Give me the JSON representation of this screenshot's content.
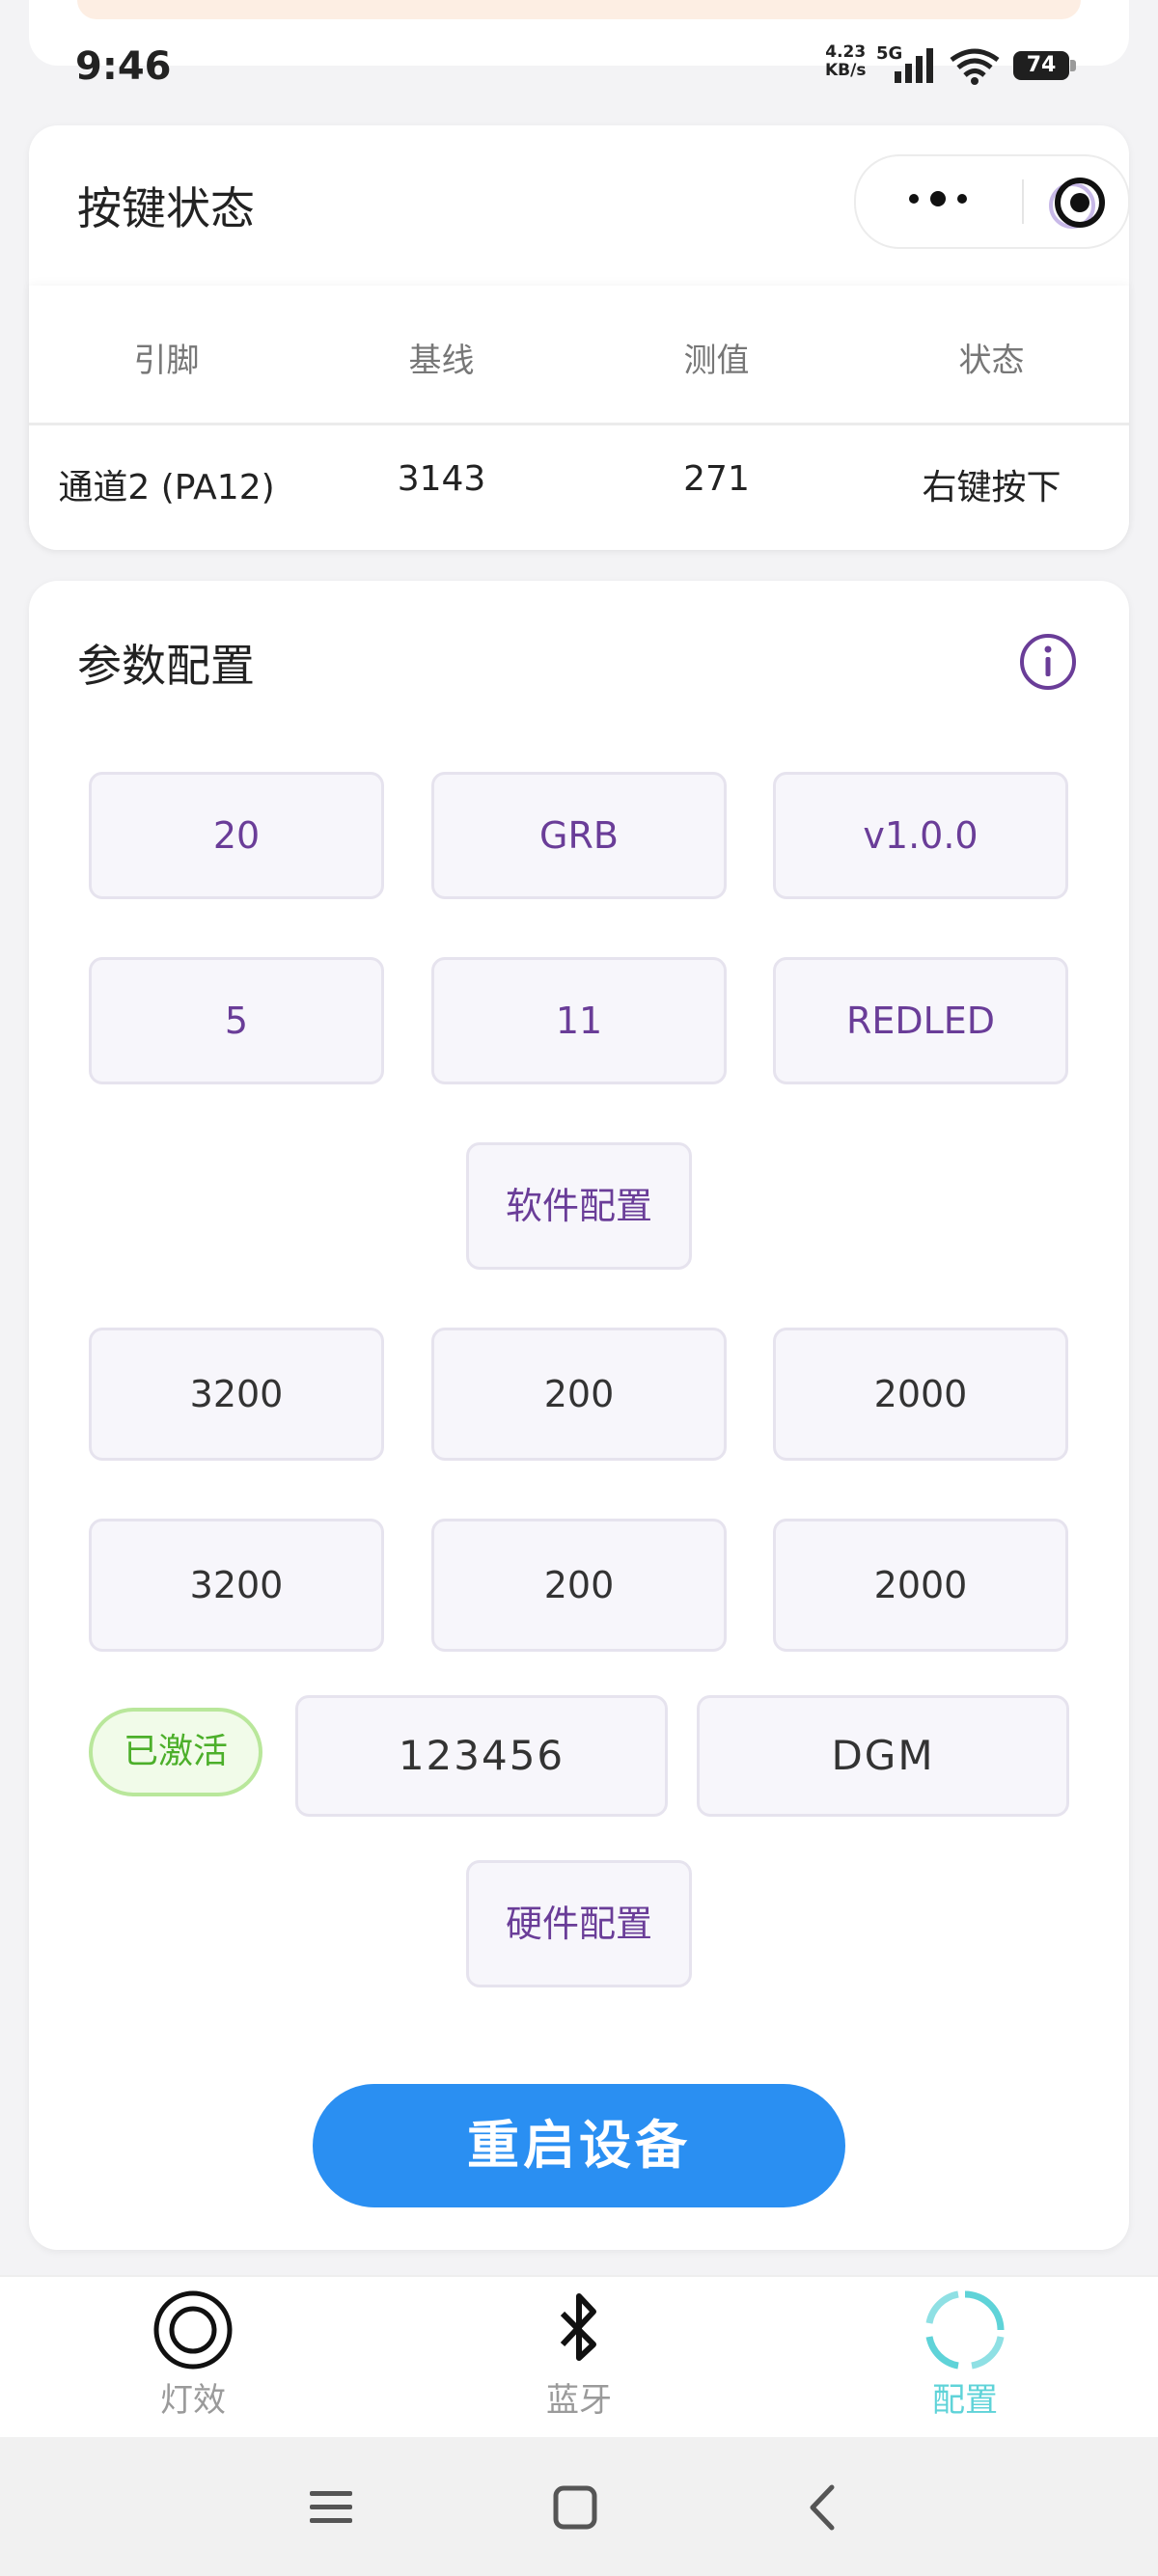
{
  "status_bar": {
    "time": "9:46",
    "net_speed_value": "4.23",
    "net_speed_unit": "KB/s",
    "network": "5G",
    "battery": "74"
  },
  "key_state": {
    "title": "按键状态",
    "columns": [
      "引脚",
      "基线",
      "测值",
      "状态"
    ],
    "row": {
      "pin": "通道2 (PA12)",
      "baseline": "3143",
      "measured": "271",
      "state": "右键按下"
    }
  },
  "params": {
    "title": "参数配置",
    "software_row1": [
      "20",
      "GRB",
      "v1.0.0"
    ],
    "software_row2": [
      "5",
      "11",
      "REDLED"
    ],
    "software_button": "软件配置",
    "hardware_row1": [
      "3200",
      "200",
      "2000"
    ],
    "hardware_row2": [
      "3200",
      "200",
      "2000"
    ],
    "activation_badge": "已激活",
    "code": "123456",
    "brand": "DGM",
    "hardware_button": "硬件配置",
    "restart_button": "重启设备"
  },
  "tabbar": {
    "tabs": [
      {
        "label": "灯效",
        "icon": "ring-icon"
      },
      {
        "label": "蓝牙",
        "icon": "bluetooth-icon"
      },
      {
        "label": "配置",
        "icon": "config-icon"
      }
    ],
    "active_tab": "配置"
  },
  "colors": {
    "accent_purple": "#6a3d98",
    "primary_blue": "#2a8ff2",
    "active_green": "#4caf2a",
    "tab_active": "#5fd3d8"
  }
}
